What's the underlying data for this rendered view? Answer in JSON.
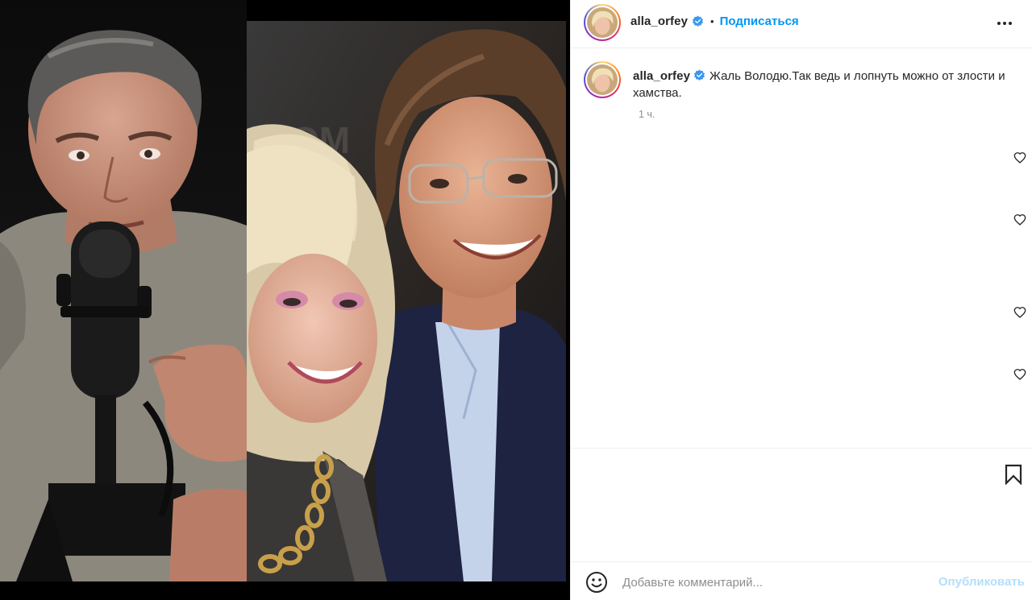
{
  "post": {
    "username": "alla_orfey",
    "verified": true,
    "follow_label": "Подписаться",
    "separator": "•"
  },
  "caption": {
    "username": "alla_orfey",
    "text": "Жаль Володю.Так ведь и лопнуть можно от злости и хамства.",
    "timestamp": "1 ч."
  },
  "comment": {
    "placeholder": "Добавьте комментарий...",
    "publish_label": "Опубликовать"
  },
  "colors": {
    "accent": "#0095f6",
    "publish_disabled": "#b2dffc",
    "text": "#262626",
    "muted": "#8e8e8e",
    "verified": "#3897f0"
  },
  "icons": {
    "more": "more-horizontal-icon",
    "verified": "verified-badge-icon",
    "like": "heart-icon",
    "save": "bookmark-icon",
    "emoji": "emoji-smile-icon"
  }
}
